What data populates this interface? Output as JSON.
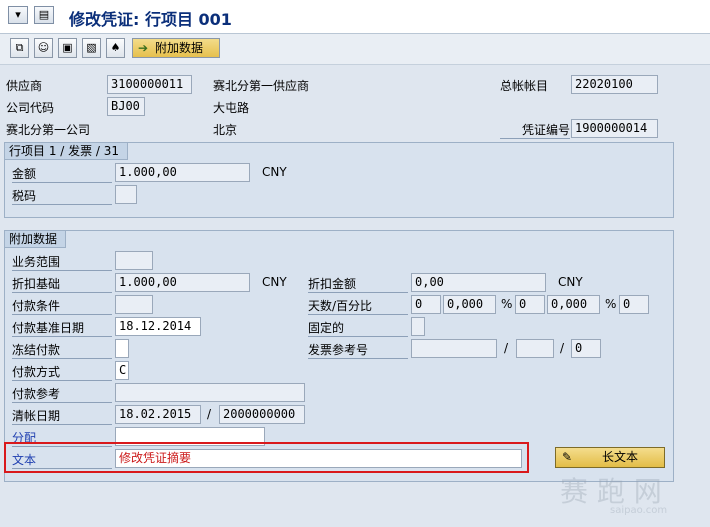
{
  "window": {
    "title": "修改凭证: 行项目 001"
  },
  "toolbar": {
    "additional_data_label": "附加数据"
  },
  "header": {
    "vendor_label": "供应商",
    "vendor_value": "3100000011",
    "vendor_name": "赛北分第一供应商",
    "gl_label": "总帐帐目",
    "gl_value": "22020100",
    "company_label": "公司代码",
    "company_value": "BJ00",
    "street": "大屯路",
    "company_name": "赛北分第一公司",
    "city": "北京",
    "doc_no_label": "凭证编号",
    "doc_no_value": "1900000014"
  },
  "item_section": {
    "title": "行项目 1 / 发票 / 31",
    "amount_label": "金额",
    "amount_value": "1.000,00",
    "currency": "CNY",
    "tax_label": "税码",
    "tax_value": ""
  },
  "extra": {
    "title": "附加数据",
    "business_area_label": "业务范围",
    "business_area_value": "",
    "discount_base_label": "折扣基础",
    "discount_base_value": "1.000,00",
    "discount_base_currency": "CNY",
    "discount_amount_label": "折扣金额",
    "discount_amount_value": "0,00",
    "discount_amount_currency": "CNY",
    "payment_terms_label": "付款条件",
    "payment_terms_value": "",
    "days_pct_label": "天数/百分比",
    "days1": "0",
    "pct1": "0,000",
    "days2": "0",
    "pct2": "0,000",
    "days3": "0",
    "pct_symbol": "%",
    "baseline_date_label": "付款基准日期",
    "baseline_date_value": "18.12.2014",
    "fixed_label": "固定的",
    "payment_block_label": "冻结付款",
    "payment_block_value": "",
    "invoice_ref_label": "发票参考号",
    "invoice_ref_1": "",
    "invoice_ref_2": "",
    "invoice_ref_3": "0",
    "payment_method_label": "付款方式",
    "payment_method_value": "C",
    "payment_ref_label": "付款参考",
    "payment_ref_value": "",
    "clearing_date_label": "清帐日期",
    "clearing_date_value": "18.02.2015",
    "clearing_doc_value": "2000000000",
    "assignment_label": "分配",
    "assignment_value": "",
    "text_label": "文本",
    "text_value": "修改凭证摘要",
    "long_text_label": "长文本"
  },
  "watermark": {
    "main": "赛 跑 网",
    "sub": "saipao.com"
  },
  "separator": "/"
}
